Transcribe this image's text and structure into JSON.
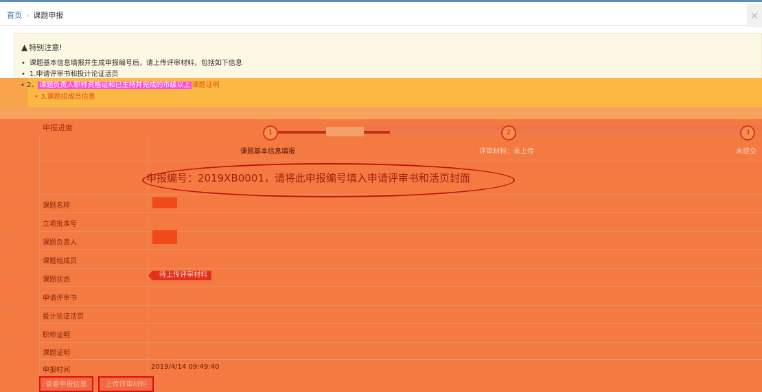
{
  "breadcrumb": {
    "home": "首页",
    "separator": "›",
    "current": "课题申报"
  },
  "close_glyph": "×",
  "notice": {
    "title": "特别注意!",
    "lines": [
      "课题基本信息填报并生成申报编号后，请上传评审材料，包括如下信息",
      "1.申请评审书和投计论证活页",
      "2.课题负责人职称资格证和已主持并完成的市级以上课题证明",
      "3.课题组成员信息"
    ],
    "line3_parts": {
      "prefix": "2、",
      "highlight": "课题负责人职称资格证和已主持并完成的市级以上",
      "tail": "课题证明"
    }
  },
  "progress": {
    "label": "申报进度",
    "steps": [
      {
        "num": "1",
        "label": "课题基本信息填报"
      },
      {
        "num": "2",
        "label": "评审材料：未上传"
      },
      {
        "num": "3",
        "label": "未提交"
      }
    ]
  },
  "serial_text": "申报编号：2019XB0001，请将此申报编号填入申请评审书和活页封面",
  "fields": {
    "name": "课题名称",
    "approval_no": "立项批准号",
    "leader": "课题负责人",
    "members": "课题组成员",
    "status": "课题状态",
    "application": "申请评审书",
    "design": "投计论证活页",
    "title_cert": "职称证明",
    "topic_cert": "课题证明",
    "time": "申报时间"
  },
  "status_value": "待上传评审材料",
  "time_value": "2019/4/14 09:49:40",
  "buttons": {
    "view": "查看申报信息",
    "upload": "上传评审材料"
  },
  "colors": {
    "accent": "#f47a42",
    "highlight": "#ff4fd8",
    "badge": "#e4301e",
    "link": "#2f6fb0"
  }
}
